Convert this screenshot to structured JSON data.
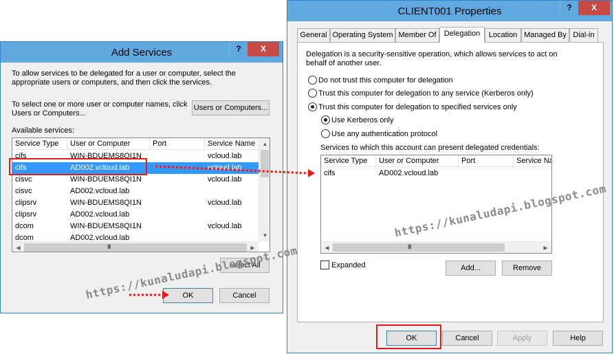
{
  "add_services": {
    "title": "Add Services",
    "help_label": "?",
    "close_label": "X",
    "intro_text": "To allow services to be delegated for a user or computer, select the appropriate users or computers, and then click the services.",
    "select_text": "To select one or more user or computer names, click Users or Computers...",
    "users_button": "Users or Computers...",
    "available_label": "Available services:",
    "columns": [
      "Service Type",
      "User or Computer",
      "Port",
      "Service Name"
    ],
    "rows": [
      {
        "type": "cifs",
        "user": "WIN-BDUEMS8QI1N",
        "port": "",
        "name": "vcloud.lab"
      },
      {
        "type": "cifs",
        "user": "AD002.vcloud.lab",
        "port": "",
        "name": "vcloud.lab"
      },
      {
        "type": "cisvc",
        "user": "WIN-BDUEMS8QI1N",
        "port": "",
        "name": "vcloud.lab"
      },
      {
        "type": "cisvc",
        "user": "AD002.vcloud.lab",
        "port": "",
        "name": ""
      },
      {
        "type": "clipsrv",
        "user": "WIN-BDUEMS8QI1N",
        "port": "",
        "name": "vcloud.lab"
      },
      {
        "type": "clipsrv",
        "user": "AD002.vcloud.lab",
        "port": "",
        "name": ""
      },
      {
        "type": "dcom",
        "user": "WIN-BDUEMS8QI1N",
        "port": "",
        "name": "vcloud.lab"
      },
      {
        "type": "dcom",
        "user": "AD002.vcloud.lab",
        "port": "",
        "name": ""
      }
    ],
    "selected_row": 1,
    "select_all": "Select All",
    "ok": "OK",
    "cancel": "Cancel"
  },
  "properties": {
    "title": "CLIENT001 Properties",
    "help_label": "?",
    "close_label": "X",
    "tabs": [
      "General",
      "Operating System",
      "Member Of",
      "Delegation",
      "Location",
      "Managed By",
      "Dial-in"
    ],
    "active_tab": "Delegation",
    "delegation_text": "Delegation is a security-sensitive operation, which allows services to act on behalf of another user.",
    "opt_no_trust": "Do not trust this computer for delegation",
    "opt_trust_any": "Trust this computer for delegation to any service (Kerberos only)",
    "opt_trust_specified": "Trust this computer for delegation to specified services only",
    "opt_kerberos": "Use Kerberos only",
    "opt_any_auth": "Use any authentication protocol",
    "services_label": "Services to which this account can present delegated credentials:",
    "columns": [
      "Service Type",
      "User or Computer",
      "Port",
      "Service Na"
    ],
    "rows": [
      {
        "type": "cifs",
        "user": "AD002.vcloud.lab",
        "port": "",
        "name": ""
      }
    ],
    "expanded": "Expanded",
    "add": "Add...",
    "remove": "Remove",
    "ok": "OK",
    "cancel": "Cancel",
    "apply": "Apply",
    "help": "Help"
  },
  "watermark": "https://kunaludapi.blogspot.com",
  "colors": {
    "titlebar": "#5fa8e0",
    "close": "#c74a43",
    "selection": "#3399ff",
    "annotation": "#e21b1b"
  },
  "scroll_glyphs": {
    "up": "▲",
    "down": "▼",
    "left": "◀",
    "right": "▶",
    "grip": "III"
  }
}
